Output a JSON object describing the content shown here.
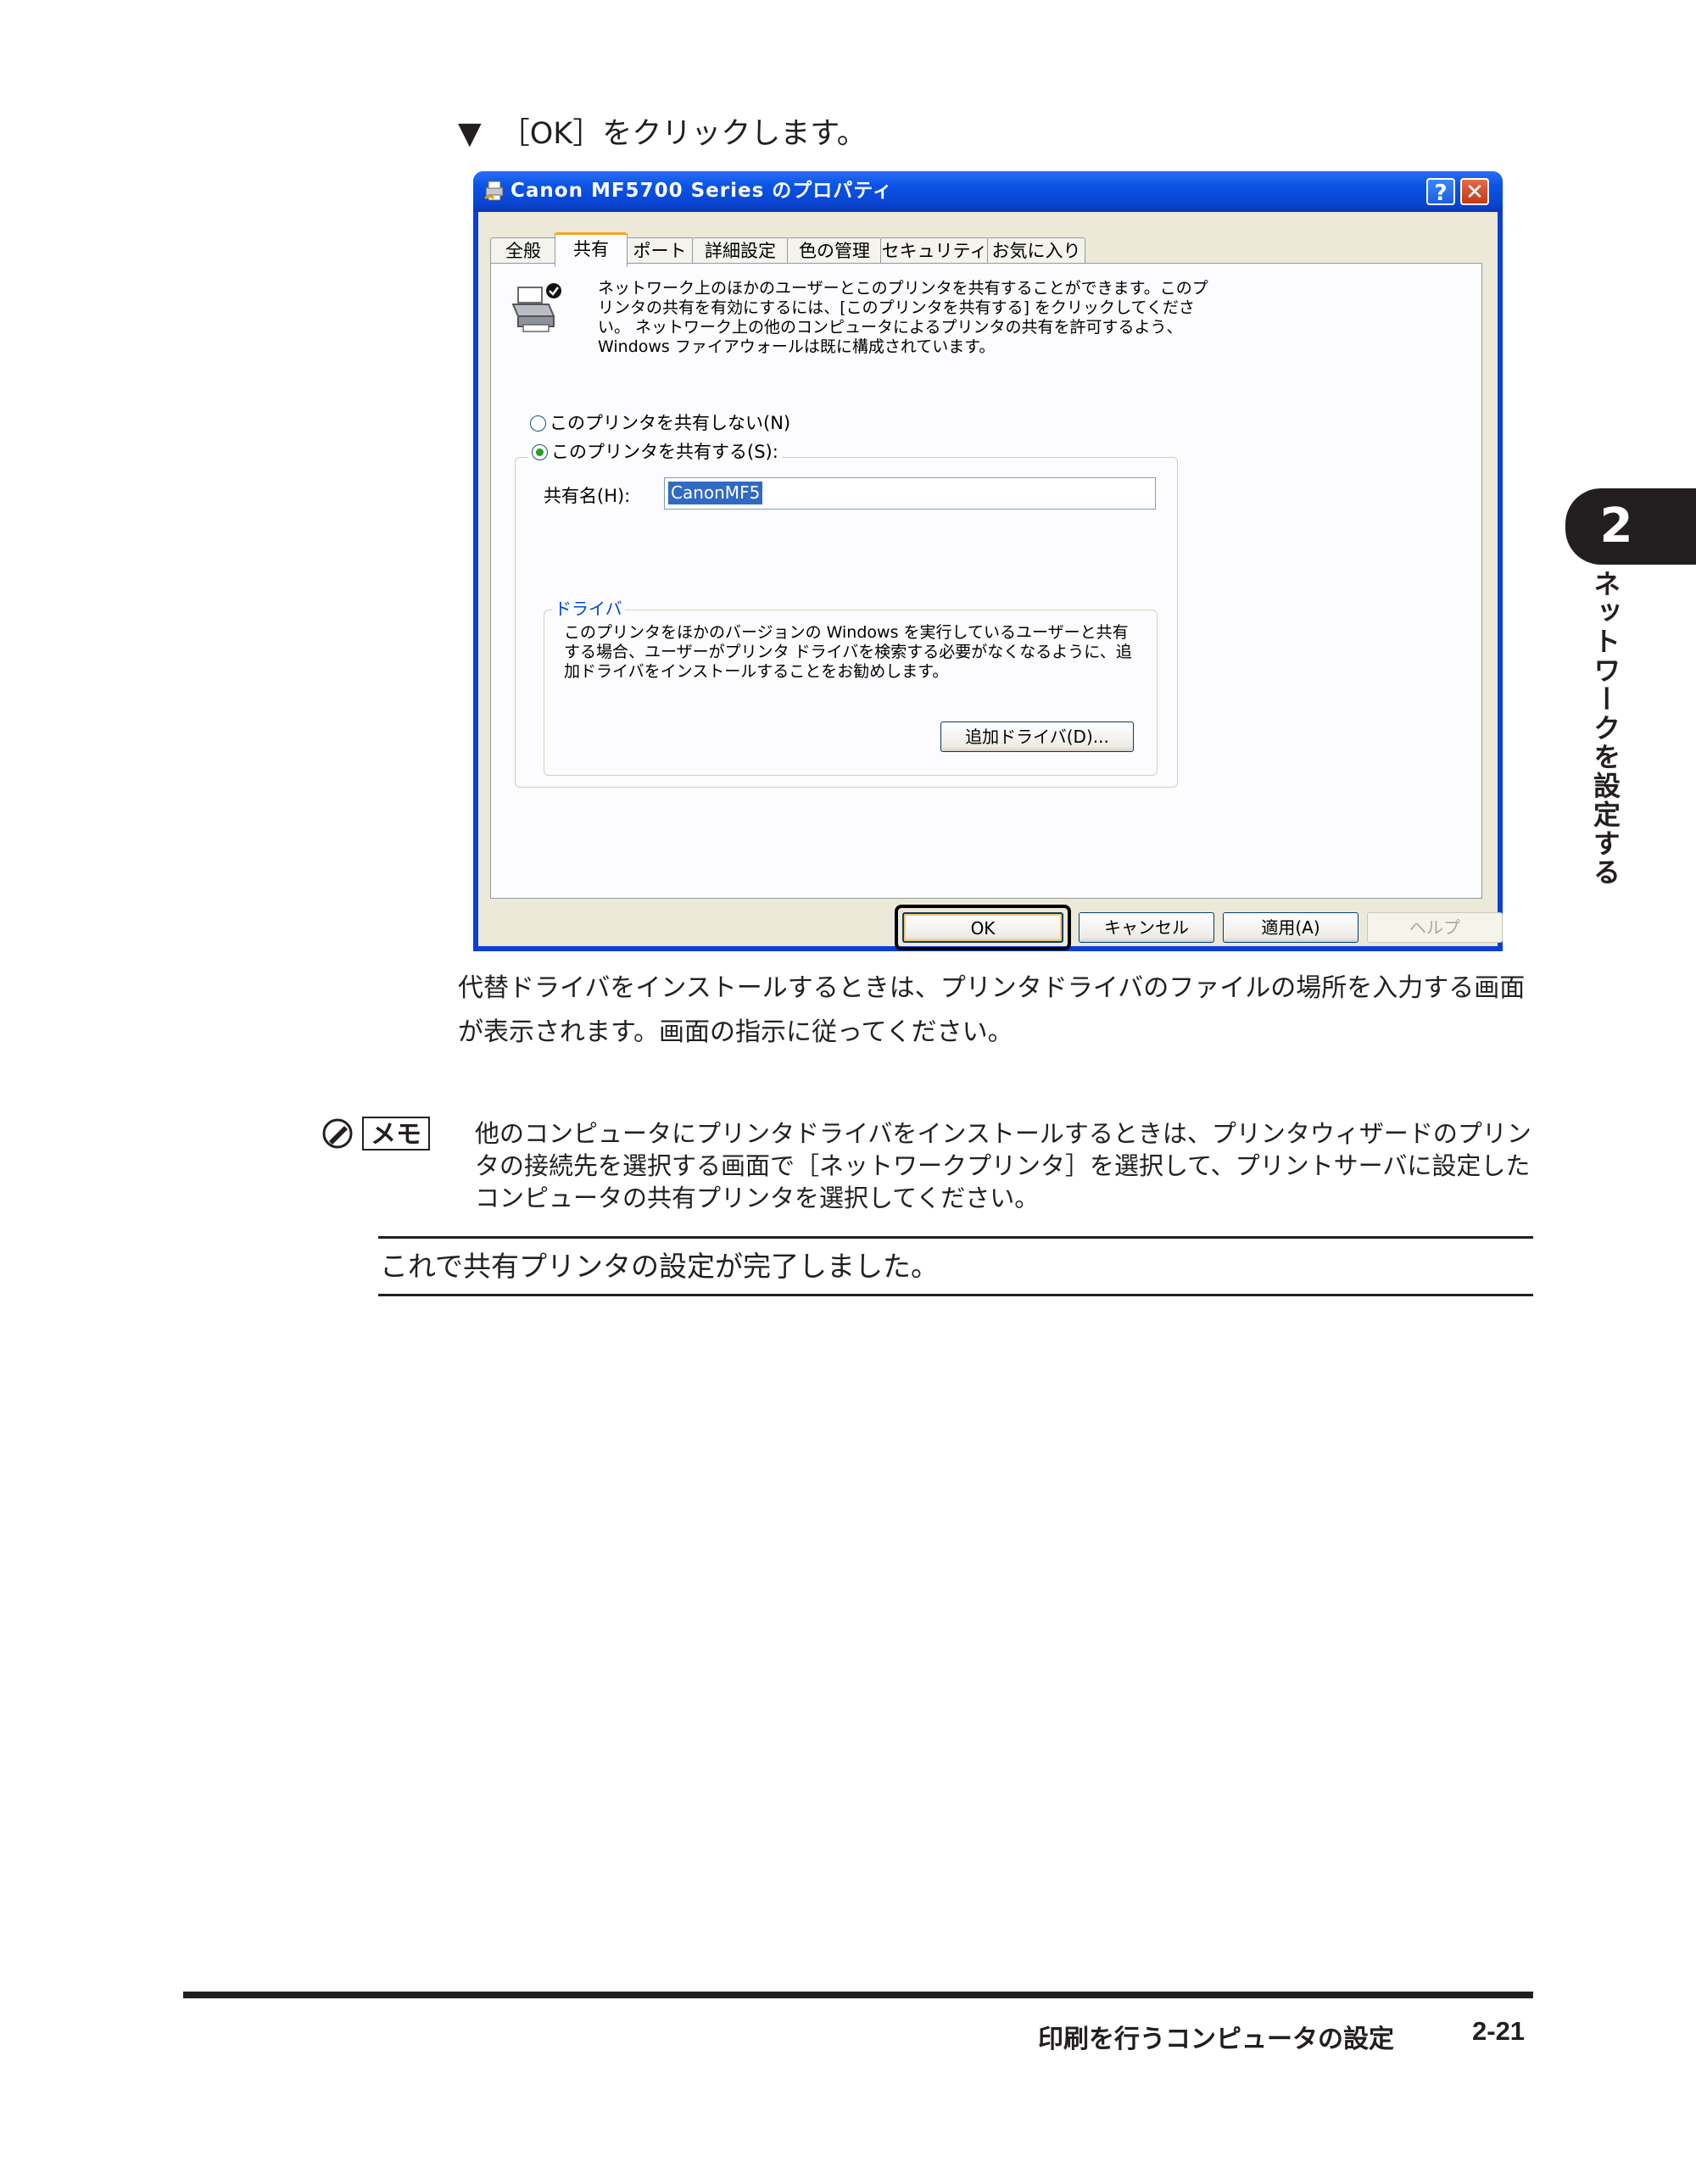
{
  "step": {
    "marker": "▼",
    "text": "［OK］をクリックします。"
  },
  "dialog": {
    "title": "Canon MF5700 Series のプロパティ",
    "help_glyph": "?",
    "close_glyph": "✕",
    "tabs": [
      {
        "label": "全般",
        "active": false
      },
      {
        "label": "共有",
        "active": true
      },
      {
        "label": "ポート",
        "active": false
      },
      {
        "label": "詳細設定",
        "active": false
      },
      {
        "label": "色の管理",
        "active": false
      },
      {
        "label": "セキュリティ",
        "active": false
      },
      {
        "label": "お気に入り",
        "active": false
      }
    ],
    "info_text": "ネットワーク上のほかのユーザーとこのプリンタを共有することができます。このプリンタの共有を有効にするには、[このプリンタを共有する] をクリックしてください。 ネットワーク上の他のコンピュータによるプリンタの共有を許可するよう、Windows ファイアウォールは既に構成されています。",
    "radio_no_share": "このプリンタを共有しない(N)",
    "radio_share": "このプリンタを共有する(S):",
    "share_name_label": "共有名(H):",
    "share_name_value": "CanonMF5",
    "driver_group_label": "ドライバ",
    "driver_text": "このプリンタをほかのバージョンの Windows を実行しているユーザーと共有する場合、ユーザーがプリンタ ドライバを検索する必要がなくなるように、追加ドライバをインストールすることをお勧めします。",
    "additional_driver_button": "追加ドライバ(D)...",
    "buttons": {
      "ok": "OK",
      "cancel": "キャンセル",
      "apply": "適用(A)",
      "help": "ヘルプ"
    }
  },
  "paragraph": "代替ドライバをインストールするときは、プリンタドライバのファイルの場所を入力する画面が表示されます。画面の指示に従ってください。",
  "memo": {
    "label": "メモ",
    "text": "他のコンピュータにプリンタドライバをインストールするときは、プリンタウィザードのプリンタの接続先を選択する画面で［ネットワークプリンタ］を選択して、プリントサーバに設定したコンピュータの共有プリンタを選択してください。"
  },
  "conclusion": "これで共有プリンタの設定が完了しました。",
  "chapter": {
    "number": "2",
    "title": "ネットワークを設定する"
  },
  "footer": {
    "title": "印刷を行うコンピュータの設定",
    "page": "2-21"
  }
}
